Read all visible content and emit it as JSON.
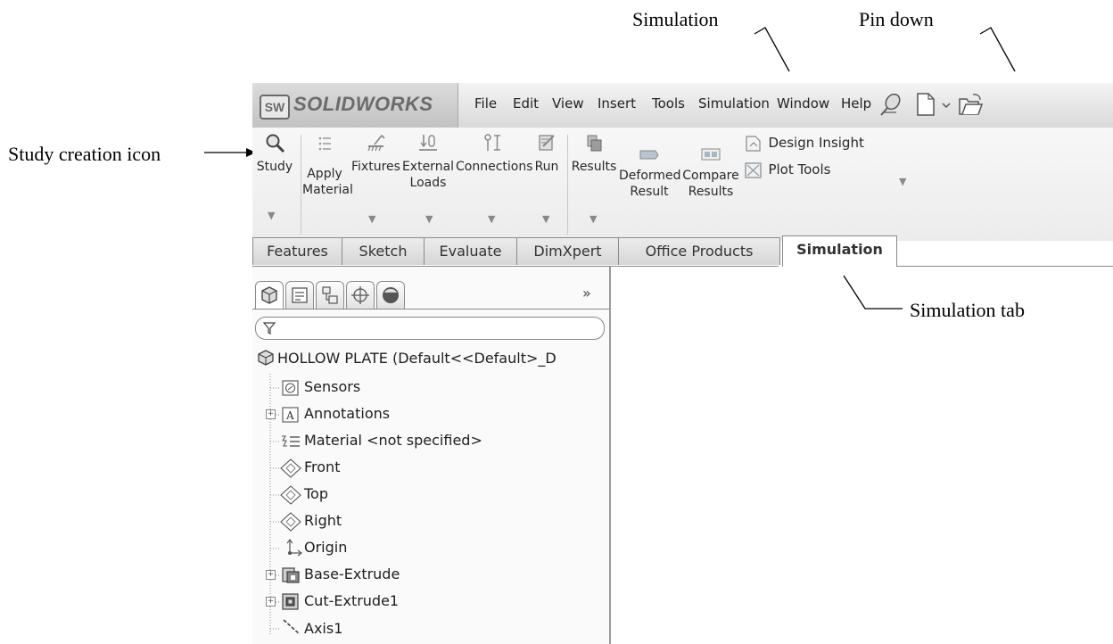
{
  "annotations": {
    "simulation_menu": "Simulation",
    "pin_down": "Pin down",
    "study_creation_icon": "Study creation icon",
    "simulation_tab": "Simulation tab"
  },
  "app": {
    "logo_text": "SOLIDWORKS",
    "logo_mark": "SW"
  },
  "menu": [
    "File",
    "Edit",
    "View",
    "Insert",
    "Tools",
    "Simulation",
    "Window",
    "Help"
  ],
  "ribbon": {
    "study": "Study",
    "apply_material_1": "Apply",
    "apply_material_2": "Material",
    "fixtures": "Fixtures",
    "external_loads_1": "External",
    "external_loads_2": "Loads",
    "connections": "Connections",
    "run": "Run",
    "results": "Results",
    "deformed_1": "Deformed",
    "deformed_2": "Result",
    "compare_1": "Compare",
    "compare_2": "Results",
    "design_insight": "Design Insight",
    "plot_tools": "Plot Tools"
  },
  "tabs": [
    "Features",
    "Sketch",
    "Evaluate",
    "DimXpert",
    "Office Products",
    "Simulation"
  ],
  "active_tab": "Simulation",
  "feature_manager": {
    "expand_glyph": "»",
    "root": "HOLLOW PLATE  (Default<<Default>_D",
    "items": [
      "Sensors",
      "Annotations",
      "Material <not specified>",
      "Front",
      "Top",
      "Right",
      "Origin",
      "Base-Extrude",
      "Cut-Extrude1",
      "Axis1"
    ]
  }
}
